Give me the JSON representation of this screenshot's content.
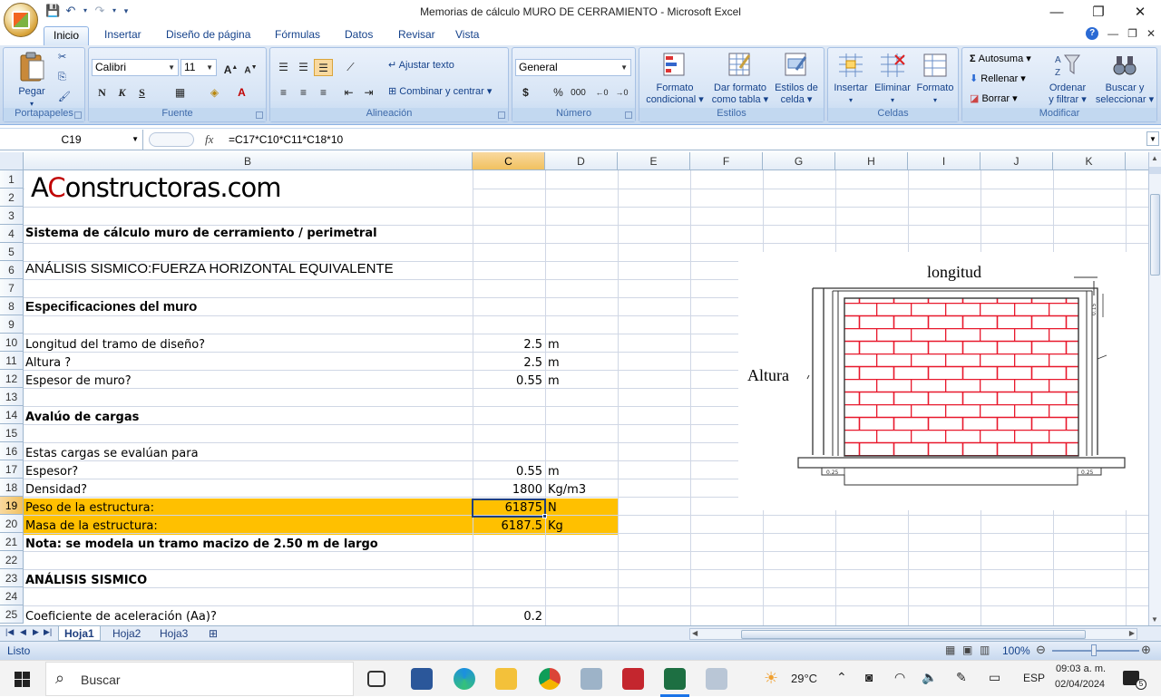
{
  "window": {
    "title": "Memorias de cálculo MURO DE CERRAMIENTO - Microsoft Excel"
  },
  "ribbon_tabs": [
    "Inicio",
    "Insertar",
    "Diseño de página",
    "Fórmulas",
    "Datos",
    "Revisar",
    "Vista"
  ],
  "groups": {
    "portapapeles": "Portapapeles",
    "fuente": "Fuente",
    "alineacion": "Alineación",
    "numero": "Número",
    "estilos": "Estilos",
    "celdas": "Celdas",
    "modificar": "Modificar"
  },
  "ribbon": {
    "pegar": "Pegar",
    "font_name": "Calibri",
    "font_size": "11",
    "ajustar_texto": "Ajustar texto",
    "combinar": "Combinar y centrar",
    "number_format": "General",
    "formato_condicional_1": "Formato",
    "formato_condicional_2": "condicional",
    "dar_formato_1": "Dar formato",
    "dar_formato_2": "como tabla",
    "estilos_celda_1": "Estilos de",
    "estilos_celda_2": "celda",
    "insertar": "Insertar",
    "eliminar": "Eliminar",
    "formato": "Formato",
    "autosuma": "Autosuma",
    "rellenar": "Rellenar",
    "borrar": "Borrar",
    "ordenar_1": "Ordenar",
    "ordenar_2": "y filtrar",
    "buscar_1": "Buscar y",
    "buscar_2": "seleccionar"
  },
  "formula_bar": {
    "name_box": "C19",
    "formula": "=C17*C10*C11*C18*10"
  },
  "columns": [
    "B",
    "C",
    "D",
    "E",
    "F",
    "G",
    "H",
    "I",
    "J",
    "K"
  ],
  "rows": [
    "1",
    "2",
    "3",
    "4",
    "5",
    "6",
    "7",
    "8",
    "9",
    "10",
    "11",
    "12",
    "13",
    "14",
    "15",
    "16",
    "17",
    "18",
    "19",
    "20",
    "21",
    "22",
    "23",
    "24",
    "25"
  ],
  "cells": {
    "logo_a": "A",
    "logo_c": "C",
    "logo_rest": "onstructoras.com",
    "b4": "Sistema de cálculo muro de cerramiento / perimetral",
    "b6": "ANÁLISIS SISMICO:FUERZA HORIZONTAL EQUIVALENTE",
    "b8": "Especificaciones del muro",
    "b10": "Longitud del tramo de diseño?",
    "c10": "2.5",
    "d10": "m",
    "b11": "Altura ?",
    "c11": "2.5",
    "d11": "m",
    "b12": "Espesor de muro?",
    "c12": "0.55",
    "d12": "m",
    "b14": "Avalúo de cargas",
    "b16": "Estas cargas se evalúan para",
    "b17": "Espesor?",
    "c17": "0.55",
    "d17": "m",
    "b18": "Densidad?",
    "c18": "1800",
    "d18": "Kg/m3",
    "b19": "Peso de la estructura:",
    "c19": "61875",
    "d19": "N",
    "b20": "Masa de la estructura:",
    "c20": "6187.5",
    "d20": "Kg",
    "b21": "Nota: se modela un tramo macizo de 2.50 m de largo",
    "b23": "ANÁLISIS SISMICO",
    "b25": "Coeficiente de aceleración (Aa)?",
    "c25": "0.2"
  },
  "drawing": {
    "longitud": "longitud",
    "altura": "Altura",
    "dim_top": "0.15",
    "dim_left": "0.25",
    "dim_right": "0.25"
  },
  "sheets": [
    "Hoja1",
    "Hoja2",
    "Hoja3"
  ],
  "status": {
    "ready": "Listo",
    "zoom": "100%"
  },
  "taskbar": {
    "search": "Buscar",
    "temperature": "29°C",
    "lang": "ESP",
    "time": "09:03 a. m.",
    "date": "02/04/2024",
    "notifications": "5"
  }
}
